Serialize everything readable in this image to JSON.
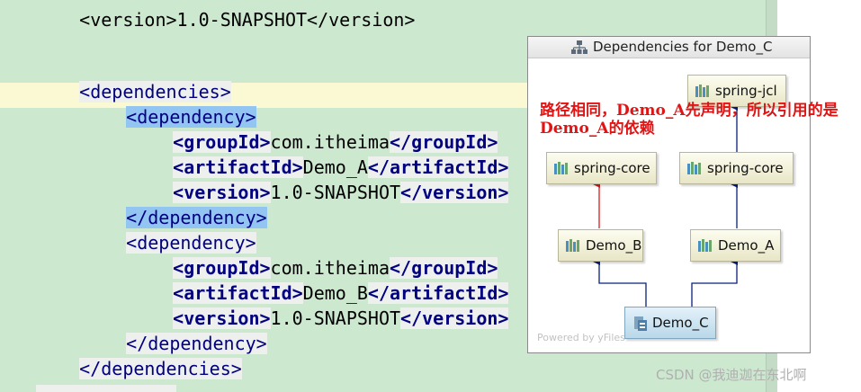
{
  "editor": {
    "top_partial_text": "<version>1.0-SNAPSHOT</version>",
    "code": {
      "dependencies_open": "<dependencies>",
      "dep1_open": "<dependency>",
      "dep1_group_open": "<groupId>",
      "dep1_group_value": "com.itheima",
      "dep1_group_close": "</groupId>",
      "dep1_artifact_open": "<artifactId>",
      "dep1_artifact_value": "Demo_A",
      "dep1_artifact_close": "</artifactId>",
      "dep1_version_open": "<version>",
      "dep1_version_value": "1.0-SNAPSHOT",
      "dep1_version_close": "</version>",
      "dep1_close": "</dependency>",
      "dep2_open": "<dependency>",
      "dep2_group_open": "<groupId>",
      "dep2_group_value": "com.itheima",
      "dep2_group_close": "</groupId>",
      "dep2_artifact_open": "<artifactId>",
      "dep2_artifact_value": "Demo_B",
      "dep2_artifact_close": "</artifactId>",
      "dep2_version_open": "<version>",
      "dep2_version_value": "1.0-SNAPSHOT",
      "dep2_version_close": "</version>",
      "dep2_close": "</dependency>",
      "dependencies_close": "</dependencies>"
    }
  },
  "popup": {
    "title": "Dependencies for Demo_C",
    "title_icon": "hierarchy-icon",
    "nodes": {
      "spring_jcl": "spring-jcl",
      "spring_core_left": "spring-core",
      "spring_core_right": "spring-core",
      "demo_b": "Demo_B",
      "demo_a": "Demo_A",
      "demo_c": "Demo_C"
    },
    "powered_by": "Powered by yFiles"
  },
  "annotation": {
    "line1": "路径相同，Demo_A先声明，所以引用的是",
    "line2": "Demo_A的依赖",
    "color": "#e01414"
  },
  "watermark": "CSDN @我迪迦在东北啊",
  "colors": {
    "editor_bg": "#cce8cf",
    "tag_highlight": "#93c5f3",
    "tag_text": "#000080",
    "edge_normal": "#0a1f7a",
    "edge_conflict": "#d81b1b"
  }
}
